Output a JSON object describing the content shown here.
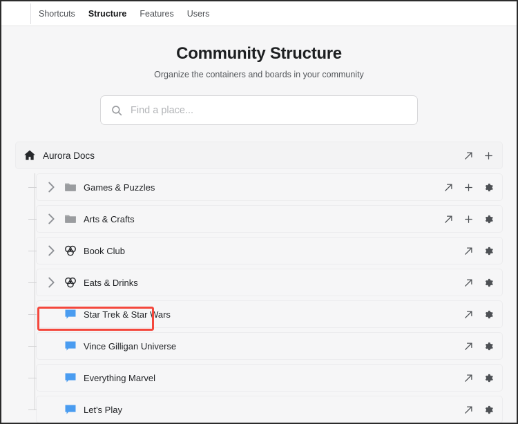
{
  "nav": {
    "tabs": [
      {
        "label": "Shortcuts",
        "active": false
      },
      {
        "label": "Structure",
        "active": true
      },
      {
        "label": "Features",
        "active": false
      },
      {
        "label": "Users",
        "active": false
      }
    ]
  },
  "page": {
    "title": "Community Structure",
    "subtitle": "Organize the containers and boards in your community"
  },
  "search": {
    "placeholder": "Find a place...",
    "value": "",
    "icon": "search-icon"
  },
  "tree": {
    "root": {
      "label": "Aurora Docs",
      "icon": "home-icon",
      "actions": [
        "open-external-icon",
        "add-icon"
      ]
    },
    "items": [
      {
        "label": "Games & Puzzles",
        "type": "folder",
        "icon": "folder-icon",
        "expandable": true,
        "actions": [
          "open-external-icon",
          "add-icon",
          "gear-icon"
        ]
      },
      {
        "label": "Arts & Crafts",
        "type": "folder",
        "icon": "folder-icon",
        "expandable": true,
        "actions": [
          "open-external-icon",
          "add-icon",
          "gear-icon"
        ]
      },
      {
        "label": "Book Club",
        "type": "group",
        "icon": "group-circles-icon",
        "expandable": true,
        "actions": [
          "open-external-icon",
          "gear-icon"
        ]
      },
      {
        "label": "Eats & Drinks",
        "type": "group",
        "icon": "group-circles-icon",
        "expandable": true,
        "actions": [
          "open-external-icon",
          "gear-icon"
        ]
      },
      {
        "label": "Star Trek & Star Wars",
        "type": "board",
        "icon": "board-bubble-icon",
        "expandable": false,
        "highlighted": true,
        "actions": [
          "open-external-icon",
          "gear-icon"
        ]
      },
      {
        "label": "Vince Gilligan Universe",
        "type": "board",
        "icon": "board-bubble-icon",
        "expandable": false,
        "actions": [
          "open-external-icon",
          "gear-icon"
        ]
      },
      {
        "label": "Everything Marvel",
        "type": "board",
        "icon": "board-bubble-icon",
        "expandable": false,
        "actions": [
          "open-external-icon",
          "gear-icon"
        ]
      },
      {
        "label": "Let's Play",
        "type": "board",
        "icon": "board-bubble-icon",
        "expandable": false,
        "actions": [
          "open-external-icon",
          "gear-icon"
        ]
      }
    ]
  },
  "colors": {
    "board_icon": "#4a9cf0",
    "folder_icon": "#9a9c9f",
    "highlight_border": "#f4473c",
    "row_background": "#f6f6f7"
  }
}
